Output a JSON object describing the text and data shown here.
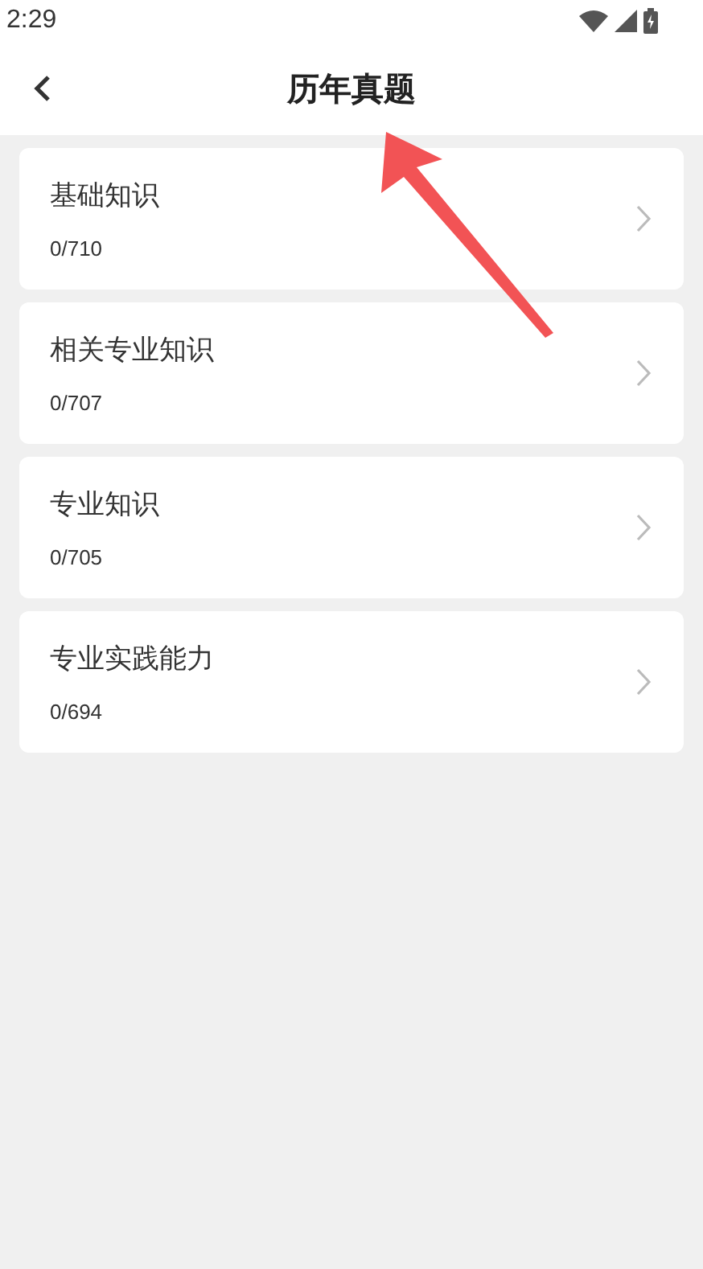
{
  "status_bar": {
    "time": "2:29"
  },
  "header": {
    "title": "历年真题"
  },
  "items": [
    {
      "title": "基础知识",
      "count": "0/710"
    },
    {
      "title": "相关专业知识",
      "count": "0/707"
    },
    {
      "title": "专业知识",
      "count": "0/705"
    },
    {
      "title": "专业实践能力",
      "count": "0/694"
    }
  ]
}
